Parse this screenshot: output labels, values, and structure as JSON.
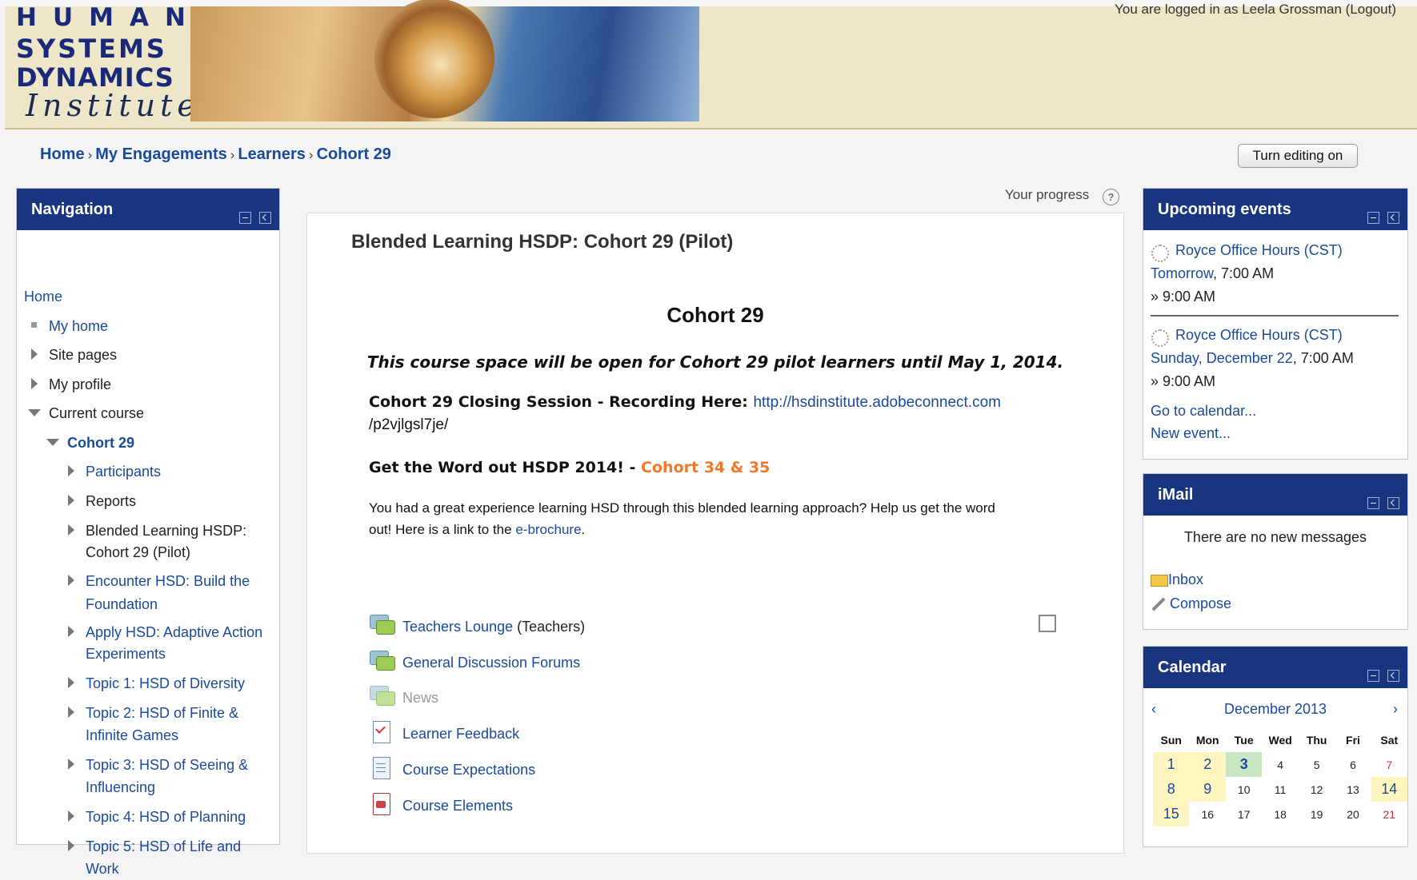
{
  "header": {
    "logo_lines": [
      "HUMAN",
      "SYSTEMS",
      "DYNAMICS",
      "Institute"
    ],
    "login_info": "You are logged in as Leela Grossman (Logout)"
  },
  "breadcrumb": [
    "Home",
    "My Engagements",
    "Learners",
    "Cohort 29"
  ],
  "edit_button": "Turn editing on",
  "navigation": {
    "title": "Navigation",
    "items": [
      {
        "label": "Home"
      },
      {
        "label": "My home"
      },
      {
        "label": "Site pages"
      },
      {
        "label": "My profile"
      },
      {
        "label": "Current course"
      },
      {
        "label": "Cohort 29"
      },
      {
        "label": "Participants"
      },
      {
        "label": "Reports"
      },
      {
        "label": "Blended Learning HSDP:"
      },
      {
        "label": "Cohort 29 (Pilot)"
      },
      {
        "label": "Encounter HSD: Build the"
      },
      {
        "label": "Foundation"
      },
      {
        "label": "Apply HSD: Adaptive Action"
      },
      {
        "label": "Experiments"
      },
      {
        "label": "Topic 1: HSD of Diversity"
      },
      {
        "label": "Topic 2: HSD of Finite &"
      },
      {
        "label": "Infinite Games"
      },
      {
        "label": "Topic 3: HSD of Seeing &"
      },
      {
        "label": "Influencing"
      },
      {
        "label": "Topic 4: HSD of Planning"
      },
      {
        "label": "Topic 5: HSD of Life and"
      },
      {
        "label": "Work"
      }
    ]
  },
  "progress_label": "Your progress",
  "main": {
    "course_title": "Blended Learning HSDP: Cohort 29 (Pilot)",
    "heading": "Cohort 29",
    "notice": "This course space will be open for Cohort 29 pilot learners until May 1, 2014.",
    "closing_label": "Cohort 29 Closing Session - Recording Here: ",
    "closing_link_1": "http://hsdinstitute.adobeconnect.com",
    "closing_link_2": "/p2vjlgsl7je/",
    "word_out_label": "Get the Word out HSDP 2014! - ",
    "word_out_link": "Cohort 34 & 35",
    "para_1": "You had a great experience learning HSD through this blended learning approach? Help us get the word",
    "para_2": "out! Here is a link to the ",
    "brochure_link": "e-brochure",
    "para_end": ".",
    "activities": [
      {
        "label": "Teachers Lounge",
        "suffix": " (Teachers)",
        "icon": "forum-icon"
      },
      {
        "label": "General Discussion Forums",
        "icon": "forum-icon"
      },
      {
        "label": "News",
        "icon": "forum-icon"
      },
      {
        "label": "Learner Feedback",
        "icon": "feedback-icon"
      },
      {
        "label": "Course Expectations",
        "icon": "page-icon"
      },
      {
        "label": "Course Elements",
        "icon": "file-icon"
      }
    ]
  },
  "upcoming": {
    "title": "Upcoming events",
    "events": [
      {
        "name": "Royce Office Hours (CST)",
        "day": "Tomorrow",
        "time": ", 7:00 AM",
        "end": "» 9:00 AM"
      },
      {
        "name": "Royce Office Hours (CST)",
        "day": "Sunday, December 22",
        "time": ", 7:00 AM",
        "end": "» 9:00 AM"
      }
    ],
    "go_calendar": "Go to calendar...",
    "new_event": "New event..."
  },
  "imail": {
    "title": "iMail",
    "message": "There are no new messages",
    "inbox": "Inbox",
    "compose": "Compose"
  },
  "calendar": {
    "title": "Calendar",
    "month": "December 2013",
    "prev": "‹",
    "next": "›",
    "weekdays": [
      "Sun",
      "Mon",
      "Tue",
      "Wed",
      "Thu",
      "Fri",
      "Sat"
    ],
    "weeks": [
      [
        "1",
        "2",
        "3",
        "4",
        "5",
        "6",
        "7"
      ],
      [
        "8",
        "9",
        "10",
        "11",
        "12",
        "13",
        "14"
      ],
      [
        "15",
        "16",
        "17",
        "18",
        "19",
        "20",
        "21"
      ]
    ]
  }
}
